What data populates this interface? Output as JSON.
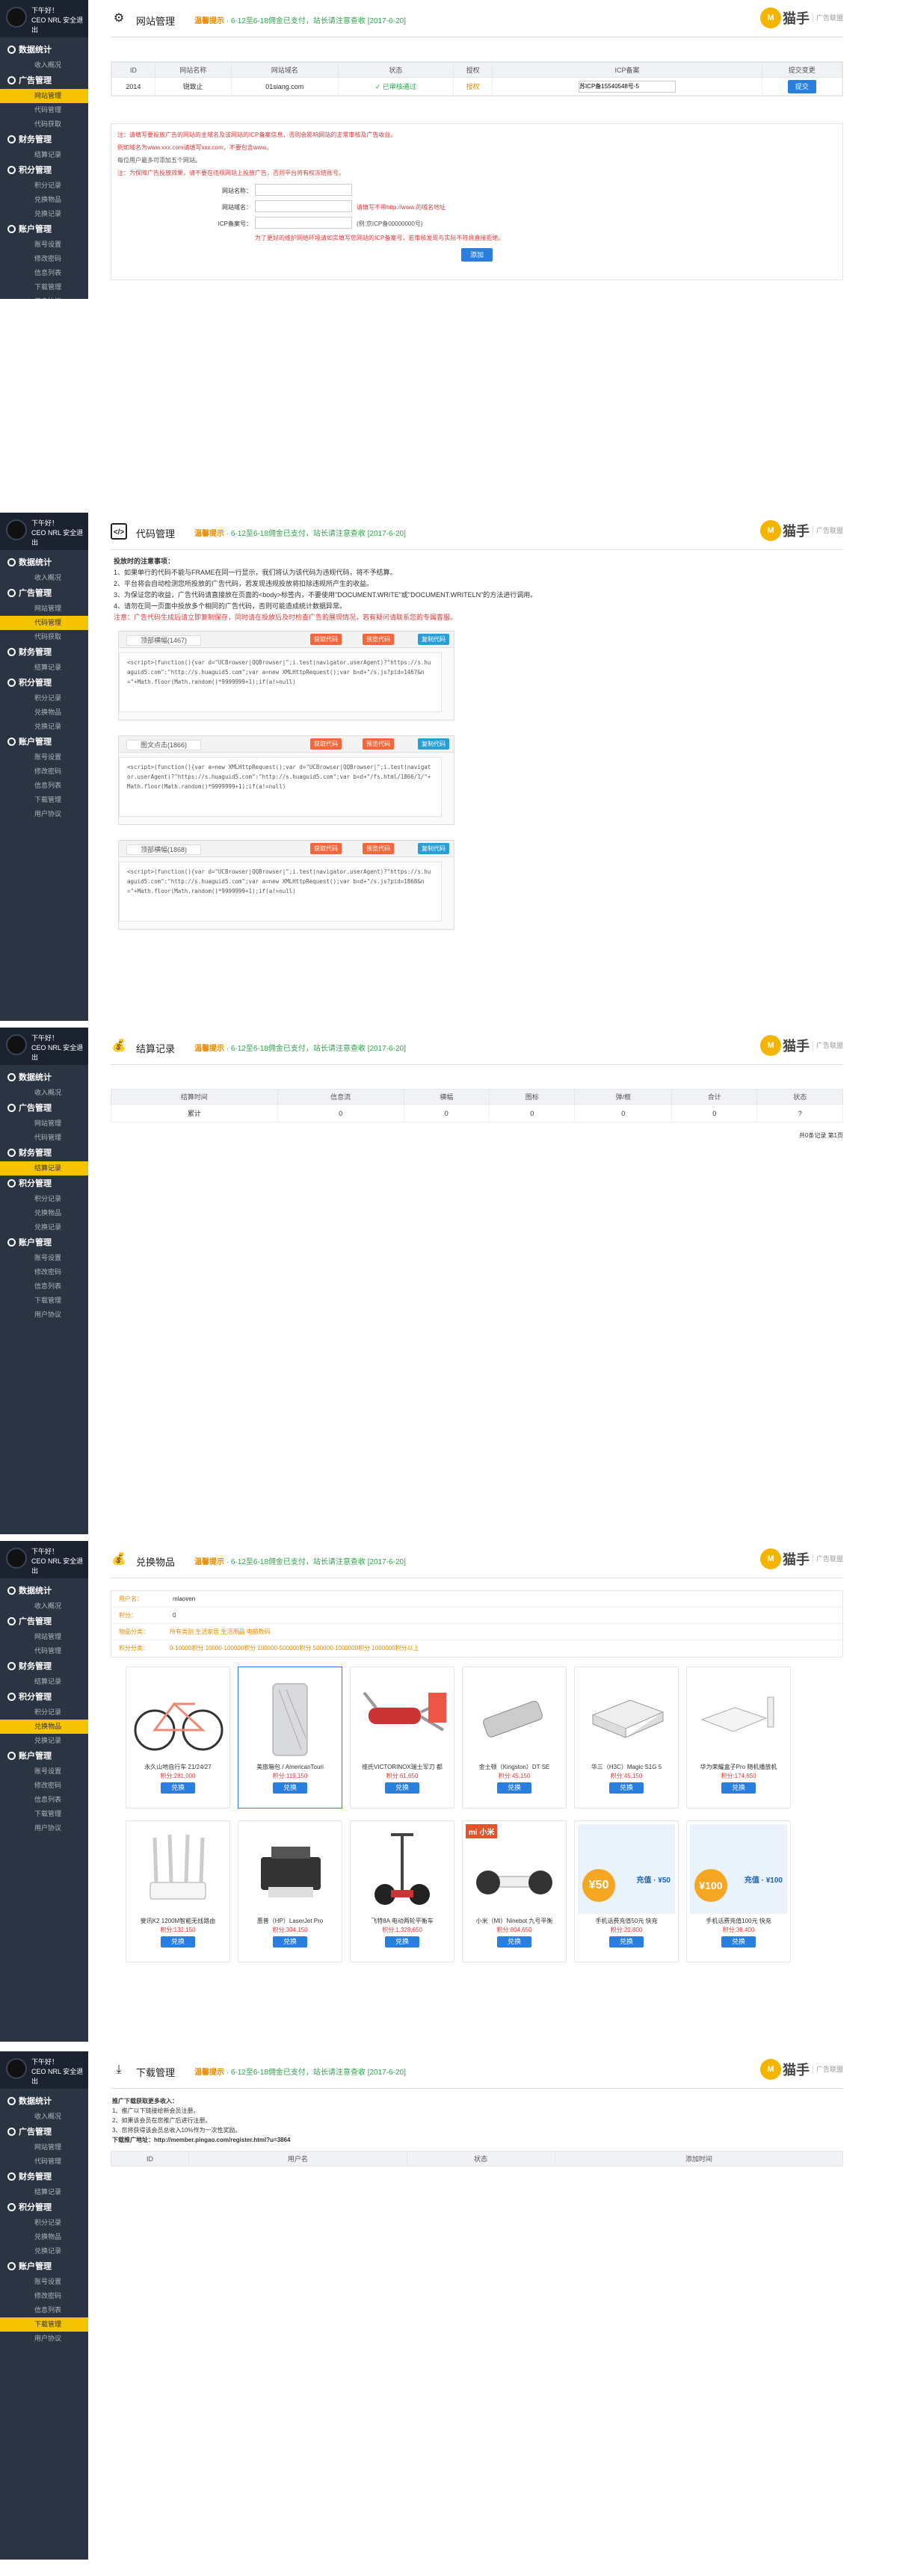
{
  "sidebar": {
    "greeting": "下午好！",
    "user": "CEO NRL  安全退出",
    "groups": {
      "stats": "数据统计",
      "stats_items": [
        "收入概况"
      ],
      "ads": "广告管理",
      "ads_items": [
        "网站管理",
        "代码管理",
        "代码获取"
      ],
      "finance": "财务管理",
      "finance_items": [
        "结算记录"
      ],
      "points": "积分管理",
      "points_items": [
        "积分记录",
        "兑换物品",
        "兑换记录"
      ],
      "account": "账户管理",
      "account_items": [
        "账号设置",
        "修改密码",
        "信息列表",
        "下载管理",
        "用户协议"
      ]
    }
  },
  "header": {
    "notice_label": "温馨提示",
    "notice": "6-12至6-18佣金已支付，站长请注意查收 [2017-6-20]",
    "logo_mark": "M",
    "logo_word": "猫手",
    "logo_sub": "广告联盟"
  },
  "site": {
    "title": "网站管理",
    "columns": [
      "ID",
      "网站名称",
      "网站域名",
      "状态",
      "授权",
      "ICP备案",
      "提交变更"
    ],
    "row": {
      "id": "2014",
      "name": "锐致止",
      "domain": "01siang.com",
      "status": "已审核通过",
      "auth": "授权",
      "icp": "苏ICP备15540548号-5",
      "action": "提交"
    },
    "notes": [
      "注：请填写要投放广告的网站的主域名及该网站的ICP备案信息，否则会影响网站的正常审核及广告收益。",
      "例如域名为www.xxx.com请填写xxx.com，不要包含www。",
      "每位用户最多可添加五个网站。",
      "注：为保障广告投放效果，请不要在违规网站上投放广告，否则平台将有权冻结账号。"
    ],
    "form": {
      "name_label": "网站名称：",
      "domain_label": "网站域名：",
      "domain_hint": "请填写不带http://www.的域名地址",
      "icp_label": "ICP备案号：",
      "icp_hint": "(例:京ICP备00000000号)",
      "icp_note": "为了更好的维护网络环境请如实填写您网站的ICP备案号，若审核发现与实际不符将直接拒绝。",
      "submit": "添加"
    }
  },
  "code": {
    "title": "代码管理",
    "notice_head": "投放时的注意事项：",
    "items": [
      "1、如果单行的代码不能与FRAME在同一行显示，我们将认为该代码为违规代码，将不予结算。",
      "2、平台将会自动检测您所投放的广告代码，若发现违规投放将扣除违规所产生的收益。",
      "3、为保证您的收益，广告代码请直接放在页面的<body>标签内，不要使用\"DOCUMENT.WRITE\"或\"DOCUMENT.WRITELN\"的方法进行调用。",
      "4、请勿在同一页面中投放多个相同的广告代码，否则可能造成统计数据异常。"
    ],
    "warning": "注意：广告代码生成后请立即复制保存，同时请在投放后及时检查广告的展现情况，若有疑问请联系您的专属客服。",
    "blocks": [
      {
        "label": "顶部横幅(1467)",
        "b1": "获取代码",
        "b2": "预览代码",
        "b3": "复制代码",
        "code": "<script>(function(){var d=\"UCBrowser|QQBrowser|\";i.test(navigator.userAgent)?\"https://s.huaguid5.com\":\"http://s.huaguid5.com\";var a=new XMLHttpRequest();var b=d+\"/s.js?pid=1467&n=\"+Math.floor(Math.random()*9999999+1);if(a!=null)"
      },
      {
        "label": "图文点击(1866)",
        "b1": "获取代码",
        "b2": "预览代码",
        "b3": "复制代码",
        "code": "<script>(function(){var a=new XMLHttpRequest();var d=\"UCBrowser|QQBrowser|\";i.test(navigator.userAgent)?\"https://s.huaguid5.com\":\"http://s.huaguid5.com\";var b=d+\"/fs.html/1866/1/\"+Math.floor(Math.random()*9999999+1);if(a!=null)"
      },
      {
        "label": "顶部横幅(1868)",
        "b1": "获取代码",
        "b2": "预览代码",
        "b3": "复制代码",
        "code": "<script>(function(){var d=\"UCBrowser|QQBrowser|\";i.test(navigator.userAgent)?\"https://s.huaguid5.com\":\"http://s.huaguid5.com\";var a=new XMLHttpRequest();var b=d+\"/s.js?pid=1868&n=\"+Math.floor(Math.random()*9999999+1);if(a!=null)"
      }
    ]
  },
  "settle": {
    "title": "结算记录",
    "columns": [
      "结算时间",
      "信息流",
      "横幅",
      "图标",
      "弹/框",
      "合计",
      "状态"
    ],
    "row": [
      "累计",
      "0",
      "0",
      "0",
      "0",
      "0",
      "?"
    ],
    "pager": "共0条记录 第1页"
  },
  "exchange": {
    "title": "兑换物品",
    "user_label": "用户名：",
    "user": "mlaoven",
    "points_label": "积分：",
    "points": "0",
    "level_label": "物品分类：",
    "level": "所有类别  生活家居  生活用品  电脑数码",
    "range_label": "积分分类：",
    "range": "0-10000积分  10000-100000积分  100000-500000积分  500000-1000000积分  1000000积分以上",
    "button": "兑换",
    "items": [
      {
        "name": "永久山地自行车 21/24/27",
        "price": "积分:281,000"
      },
      {
        "name": "美旅箱包 / AmericanTouri",
        "price": "积分:119,150"
      },
      {
        "name": "维氏VICTORINOX瑞士军刀 都",
        "price": "积分:61,650"
      },
      {
        "name": "金士顿（Kingston）DT SE",
        "price": "积分:45,150"
      },
      {
        "name": "华三（H3C）Magic S1G 5",
        "price": "积分:45,150"
      },
      {
        "name": "华为荣耀盒子Pro 随机播放机",
        "price": "积分:174,650"
      },
      {
        "name": "斐讯K2 1200M智能无线路由",
        "price": "积分:132,150"
      },
      {
        "name": "惠普（HP）LaserJet Pro",
        "price": "积分:304,150"
      },
      {
        "name": "飞特8A 电动两轮平衡车",
        "price": "积分:1,328,650"
      },
      {
        "name": "小米（MI）Ninebot 九号平衡",
        "price": "积分:804,650"
      },
      {
        "name": "手机话费充值50元 快充",
        "price": "积分:20,800"
      },
      {
        "name": "手机话费充值100元 快充",
        "price": "积分:38,400"
      }
    ]
  },
  "download": {
    "title": "下载管理",
    "head": "推广下载获取更多收入：",
    "lines": [
      "1、推广以下链接给新会员注册。",
      "2、如果该会员在您推广后进行注册。",
      "3、您将获得该会员总收入10%作为一次性奖励。"
    ],
    "link_label": "下载推广地址：http://member.pingao.com/register.html?u=3864",
    "columns": [
      "ID",
      "用户名",
      "状态",
      "添加时间"
    ]
  },
  "colors": {
    "sidebar": "#2b3442",
    "active": "#f6c300",
    "primary": "#2a7fde",
    "notice": "#2ea54d"
  }
}
